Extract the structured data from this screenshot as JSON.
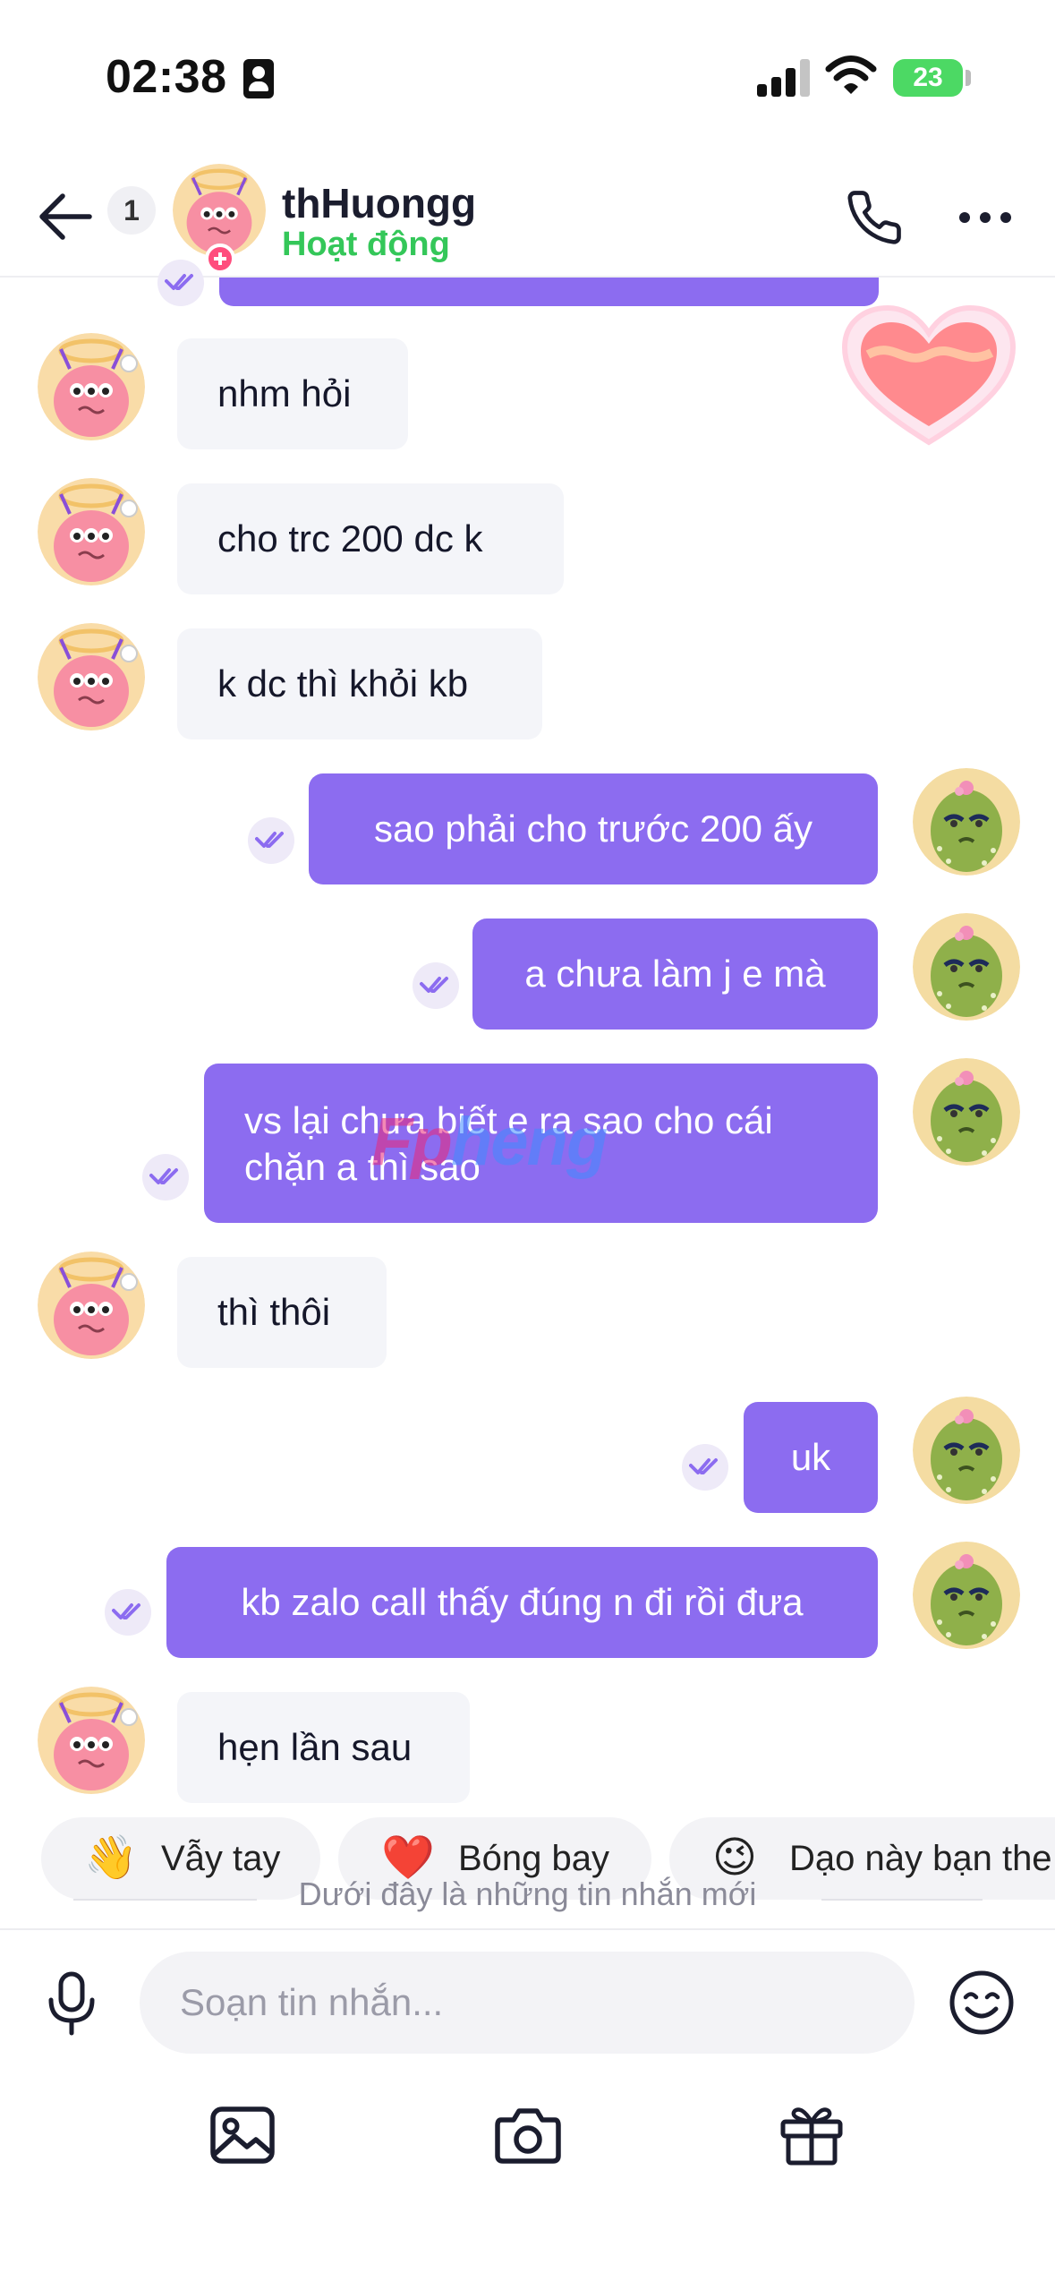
{
  "status_bar": {
    "time": "02:38",
    "battery": "23"
  },
  "header": {
    "unread_count": "1",
    "contact_name": "thHuongg",
    "contact_status": "Hoạt động"
  },
  "messages": [
    {
      "side": "in",
      "text": "nhm hỏi"
    },
    {
      "side": "in",
      "text": "cho trc 200 dc k"
    },
    {
      "side": "in",
      "text": "k dc thì khỏi kb"
    },
    {
      "side": "out",
      "text": "sao phải cho trước 200 ấy"
    },
    {
      "side": "out",
      "text": "a chưa làm j e mà"
    },
    {
      "side": "out",
      "line1": "vs lại chưa biết e ra sao cho cái",
      "line2": "chặn a thì sao"
    },
    {
      "side": "in",
      "text": "thì thôi"
    },
    {
      "side": "out",
      "text": "uk"
    },
    {
      "side": "out",
      "text": "kb zalo call thấy đúng n đi rồi đưa"
    },
    {
      "side": "in",
      "text": "hẹn lần sau"
    }
  ],
  "suggestions": [
    {
      "emoji": "👋",
      "label": "Vẫy tay"
    },
    {
      "emoji": "❤️",
      "label": "Bóng bay"
    },
    {
      "emoji": "😉",
      "label": "Dạo này bạn the"
    }
  ],
  "divider_text": "Dưới đây là những tin nhắn mới",
  "composer": {
    "placeholder": "Soạn tin nhắn..."
  },
  "watermark": {
    "part1": "Fp",
    "part2": "heng"
  },
  "colors": {
    "outgoing_bubble": "#8c6cf0",
    "incoming_bubble": "#f4f5f9",
    "status_green": "#34c759"
  }
}
